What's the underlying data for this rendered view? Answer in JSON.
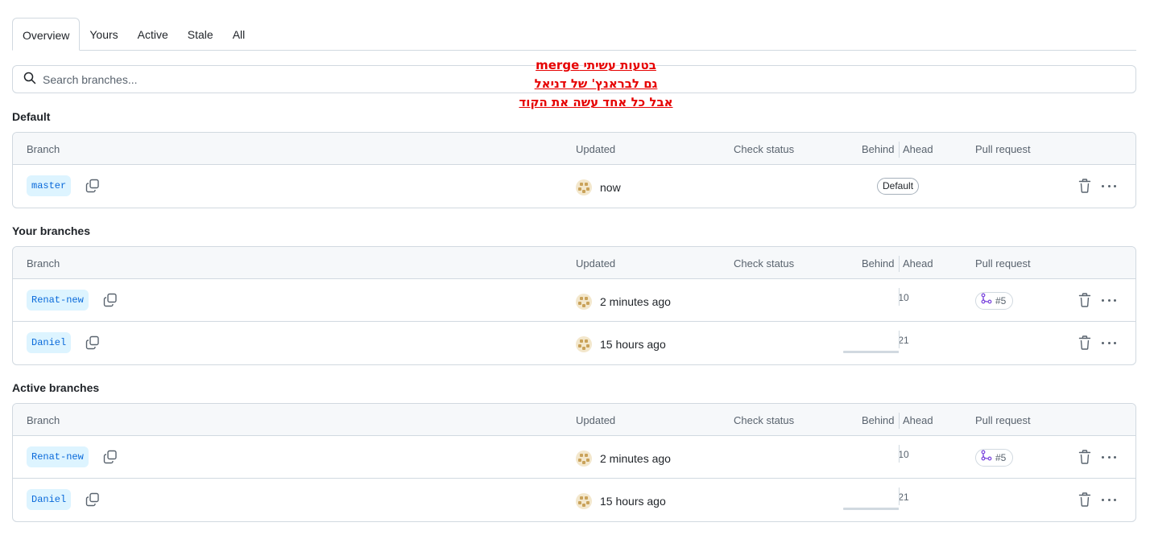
{
  "tabs": [
    "Overview",
    "Yours",
    "Active",
    "Stale",
    "All"
  ],
  "search": {
    "placeholder": "Search branches..."
  },
  "annotation": {
    "lines": [
      "בטעות עשיתי merge",
      "גם לבראנץ' של דניאל",
      "אבל כל אחד עשה את הקוד"
    ],
    "color": "#e60000"
  },
  "columns": {
    "branch": "Branch",
    "updated": "Updated",
    "check": "Check status",
    "behind": "Behind",
    "ahead": "Ahead",
    "pr": "Pull request"
  },
  "sections": [
    {
      "title": "Default",
      "rows": [
        {
          "branch": "master",
          "updated": "now",
          "default_label": "Default"
        }
      ]
    },
    {
      "title": "Your branches",
      "rows": [
        {
          "branch": "Renat-new",
          "updated": "2 minutes ago",
          "behind": "1",
          "ahead": "0",
          "pr": "#5"
        },
        {
          "branch": "Daniel",
          "updated": "15 hours ago",
          "behind": "2",
          "ahead": "1"
        }
      ]
    },
    {
      "title": "Active branches",
      "rows": [
        {
          "branch": "Renat-new",
          "updated": "2 minutes ago",
          "behind": "1",
          "ahead": "0",
          "pr": "#5"
        },
        {
          "branch": "Daniel",
          "updated": "15 hours ago",
          "behind": "2",
          "ahead": "1"
        }
      ]
    }
  ],
  "icons": {
    "search": "search-icon",
    "copy": "copy-icon",
    "trash": "trash-icon",
    "more": "kebab-horizontal-icon",
    "pr": "git-pull-request-icon"
  },
  "colors": {
    "branch_bg": "#ddf4ff",
    "branch_fg": "#0969da",
    "pr_icon": "#8250df"
  }
}
